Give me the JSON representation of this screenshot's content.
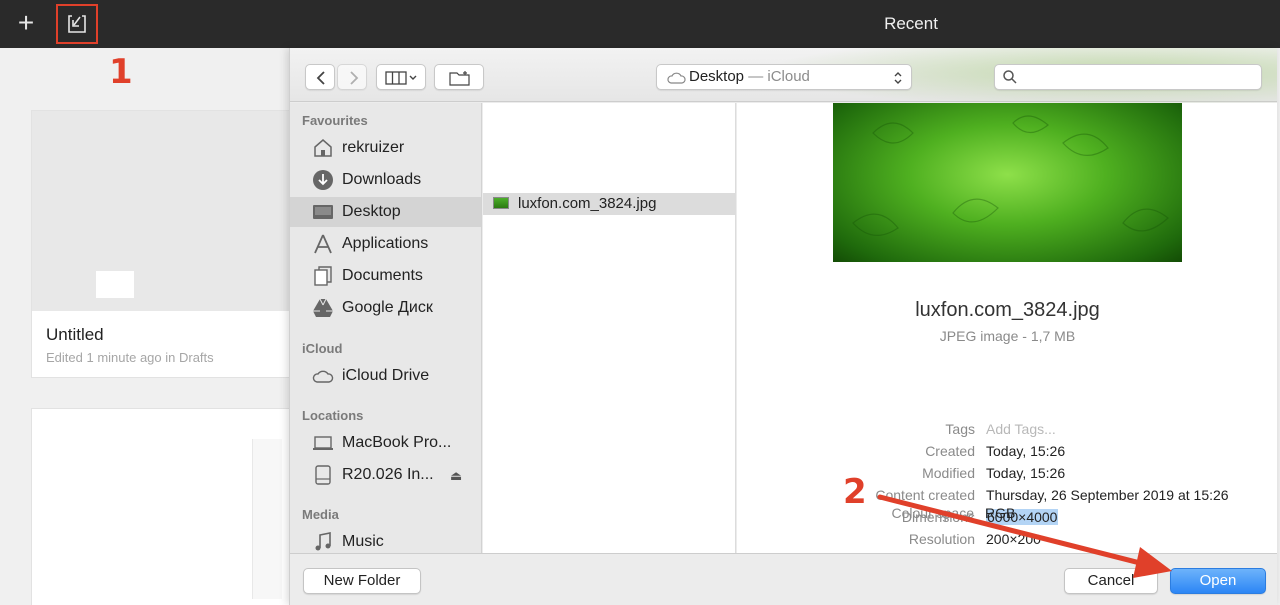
{
  "app": {
    "title": "Recent",
    "new_icon": "plus-icon",
    "import_icon": "import-icon"
  },
  "background": {
    "card1": {
      "name": "Untitled",
      "meta": "Edited 1 minute ago in Drafts"
    }
  },
  "annotations": {
    "step1": "1",
    "step2": "2",
    "accent": "#e0402a"
  },
  "dialog": {
    "location": {
      "folder": "Desktop",
      "suffix": " — iCloud"
    },
    "search": {
      "placeholder": ""
    },
    "sidebar": {
      "sections": [
        {
          "title": "Favourites",
          "items": [
            {
              "label": "rekruizer",
              "icon": "home-icon"
            },
            {
              "label": "Downloads",
              "icon": "download-icon"
            },
            {
              "label": "Desktop",
              "icon": "desktop-icon",
              "selected": true
            },
            {
              "label": "Applications",
              "icon": "applications-icon"
            },
            {
              "label": "Documents",
              "icon": "documents-icon"
            },
            {
              "label": "Google Диск",
              "icon": "google-drive-icon"
            }
          ]
        },
        {
          "title": "iCloud",
          "items": [
            {
              "label": "iCloud Drive",
              "icon": "cloud-icon"
            }
          ]
        },
        {
          "title": "Locations",
          "items": [
            {
              "label": "MacBook Pro...",
              "icon": "laptop-icon"
            },
            {
              "label": "R20.026 In...",
              "icon": "drive-icon"
            }
          ]
        },
        {
          "title": "Media",
          "items": [
            {
              "label": "Music",
              "icon": "music-icon"
            }
          ]
        }
      ]
    },
    "files": [
      {
        "name": "luxfon.com_3824.jpg",
        "selected": true
      }
    ],
    "preview": {
      "name": "luxfon.com_3824.jpg",
      "kind": "JPEG image - 1,7 MB",
      "tags_label": "Tags",
      "tags_placeholder": "Add Tags...",
      "details": [
        {
          "key": "Created",
          "value": "Today, 15:26"
        },
        {
          "key": "Modified",
          "value": "Today, 15:26"
        },
        {
          "key": "Content created",
          "value": "Thursday, 26 September 2019 at 15:26"
        },
        {
          "key": "Dimensions",
          "value": "6000×4000"
        },
        {
          "key": "Resolution",
          "value": "200×200"
        },
        {
          "key": "Colour space",
          "value": "RGB"
        }
      ]
    },
    "footer": {
      "new_folder": "New Folder",
      "cancel": "Cancel",
      "open": "Open"
    }
  }
}
